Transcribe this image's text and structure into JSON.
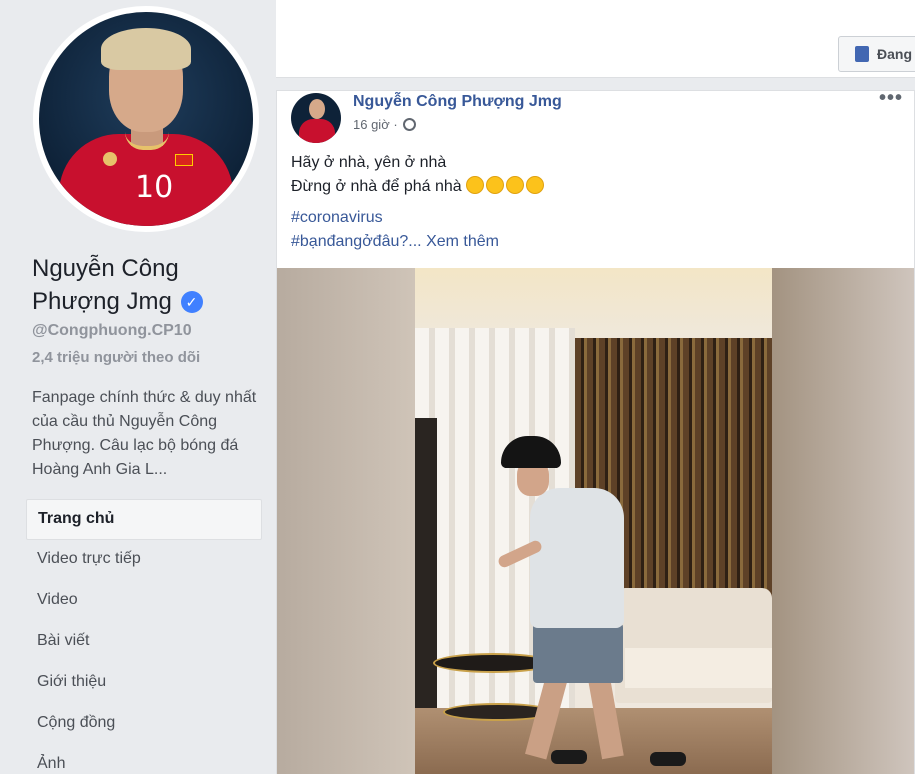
{
  "sidebar": {
    "page_name": "Nguyễn Công Phượng Jmg",
    "handle": "@Congphuong.CP10",
    "followers": "2,4 triệu người theo dõi",
    "about": "Fanpage chính thức & duy nhất của cầu thủ Nguyễn Công Phượng. Câu lạc bộ bóng đá Hoàng Anh Gia L...",
    "nav": [
      {
        "label": "Trang chủ",
        "active": true
      },
      {
        "label": "Video trực tiếp"
      },
      {
        "label": "Video"
      },
      {
        "label": "Bài viết"
      },
      {
        "label": "Giới thiệu"
      },
      {
        "label": "Cộng đồng"
      },
      {
        "label": "Ảnh"
      }
    ]
  },
  "header": {
    "button_label": "Đang"
  },
  "post": {
    "author": "Nguyễn Công Phượng Jmg",
    "time": "16 giờ ·",
    "line1": "Hãy ở nhà, yên ở nhà",
    "line2": "Đừng ở nhà để phá nhà",
    "hashtag1": "#coronavirus",
    "hashtag2": "#bạnđangởđâu?...",
    "see_more": "Xem thêm",
    "more_menu": "•••"
  },
  "colors": {
    "link": "#385898",
    "accent": "#4267b2",
    "verified": "#4080ff"
  }
}
